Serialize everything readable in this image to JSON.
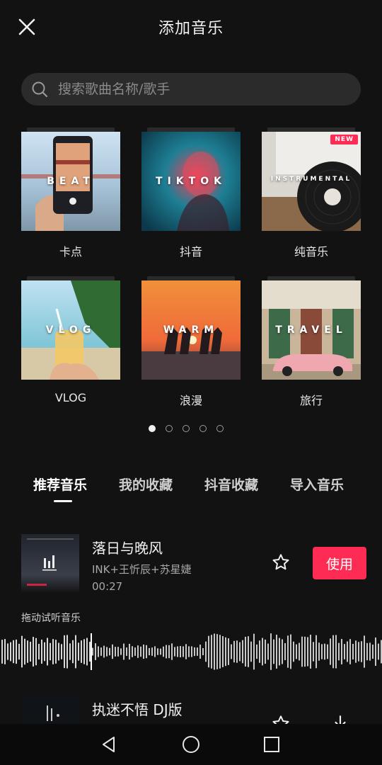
{
  "header": {
    "title": "添加音乐",
    "close_icon": "close-icon"
  },
  "search": {
    "placeholder": "搜索歌曲名称/歌手",
    "value": "",
    "icon": "search-icon"
  },
  "categories": [
    {
      "label": "卡点",
      "cover_text": "BEAT",
      "badge": ""
    },
    {
      "label": "抖音",
      "cover_text": "TIKTOK",
      "badge": ""
    },
    {
      "label": "纯音乐",
      "cover_text": "INSTRUMENTAL",
      "badge": "NEW"
    },
    {
      "label": "VLOG",
      "cover_text": "VLOG",
      "badge": ""
    },
    {
      "label": "浪漫",
      "cover_text": "WARM",
      "badge": ""
    },
    {
      "label": "旅行",
      "cover_text": "TRAVEL",
      "badge": ""
    }
  ],
  "pager": {
    "pages": 5,
    "active": 0
  },
  "tabs": [
    {
      "label": "推荐音乐",
      "active": true
    },
    {
      "label": "我的收藏",
      "active": false
    },
    {
      "label": "抖音收藏",
      "active": false
    },
    {
      "label": "导入音乐",
      "active": false
    }
  ],
  "songs": [
    {
      "title": "落日与晚风",
      "artist": "INK+王忻辰+苏星婕",
      "duration": "00:27",
      "action_label": "使用"
    },
    {
      "title": "执迷不悟 DJ版",
      "artist": "",
      "duration": ""
    }
  ],
  "preview_hint": "拖动试听音乐",
  "colors": {
    "accent": "#fe2c55",
    "background": "#121212"
  },
  "navbar": {
    "icons": [
      "back-triangle-icon",
      "home-circle-icon",
      "recents-square-icon"
    ]
  }
}
